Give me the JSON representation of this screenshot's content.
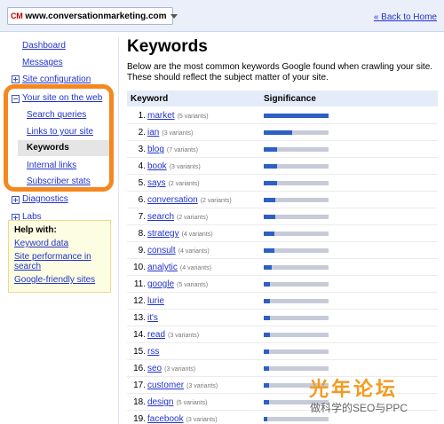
{
  "topbar": {
    "site_badge": "CM",
    "site_name": "www.conversationmarketing.com",
    "back_link": "« Back to Home"
  },
  "nav": {
    "dashboard": "Dashboard",
    "messages": "Messages",
    "site_configuration": "Site configuration",
    "your_site_on_the_web": "Your site on the web",
    "sub_items": [
      "Search queries",
      "Links to your site",
      "Keywords",
      "Internal links",
      "Subscriber stats"
    ],
    "selected_sub_item": "Keywords",
    "diagnostics": "Diagnostics",
    "labs": "Labs"
  },
  "help": {
    "title": "Help with:",
    "links": [
      "Keyword data",
      "Site performance in search",
      "Google-friendly sites"
    ]
  },
  "main": {
    "title": "Keywords",
    "description": "Below are the most common keywords Google found when crawling your site. These should reflect the subject matter of your site.",
    "col_keyword": "Keyword",
    "col_significance": "Significance",
    "rows": [
      {
        "num": "1.",
        "keyword": "market",
        "variants": "(5 variants)",
        "significance": 1.0
      },
      {
        "num": "2.",
        "keyword": "ian",
        "variants": "(3 variants)",
        "significance": 0.44
      },
      {
        "num": "3.",
        "keyword": "blog",
        "variants": "(7 variants)",
        "significance": 0.2
      },
      {
        "num": "4.",
        "keyword": "book",
        "variants": "(3 variants)",
        "significance": 0.2
      },
      {
        "num": "5.",
        "keyword": "says",
        "variants": "(2 variants)",
        "significance": 0.2
      },
      {
        "num": "6.",
        "keyword": "conversation",
        "variants": "(2 variants)",
        "significance": 0.18
      },
      {
        "num": "7.",
        "keyword": "search",
        "variants": "(2 variants)",
        "significance": 0.18
      },
      {
        "num": "8.",
        "keyword": "strategy",
        "variants": "(4 variants)",
        "significance": 0.16
      },
      {
        "num": "9.",
        "keyword": "consult",
        "variants": "(4 variants)",
        "significance": 0.16
      },
      {
        "num": "10.",
        "keyword": "analytic",
        "variants": "(4 variants)",
        "significance": 0.12
      },
      {
        "num": "11.",
        "keyword": "google",
        "variants": "(5 variants)",
        "significance": 0.1
      },
      {
        "num": "12.",
        "keyword": "lurie",
        "variants": "",
        "significance": 0.1
      },
      {
        "num": "13.",
        "keyword": "it's",
        "variants": "",
        "significance": 0.1
      },
      {
        "num": "14.",
        "keyword": "read",
        "variants": "(3 variants)",
        "significance": 0.1
      },
      {
        "num": "15.",
        "keyword": "rss",
        "variants": "",
        "significance": 0.08
      },
      {
        "num": "16.",
        "keyword": "seo",
        "variants": "(3 variants)",
        "significance": 0.08
      },
      {
        "num": "17.",
        "keyword": "customer",
        "variants": "(3 variants)",
        "significance": 0.08
      },
      {
        "num": "18.",
        "keyword": "design",
        "variants": "(5 variants)",
        "significance": 0.08
      },
      {
        "num": "19.",
        "keyword": "facebook",
        "variants": "(3 variants)",
        "significance": 0.06
      }
    ]
  },
  "watermark": {
    "chinese": "光年论坛",
    "subtitle": "做科学的SEO与PPC"
  },
  "colors": {
    "accent_orange": "#f5871f",
    "bar_fill": "#2e5fc4",
    "link": "#2233cc"
  }
}
